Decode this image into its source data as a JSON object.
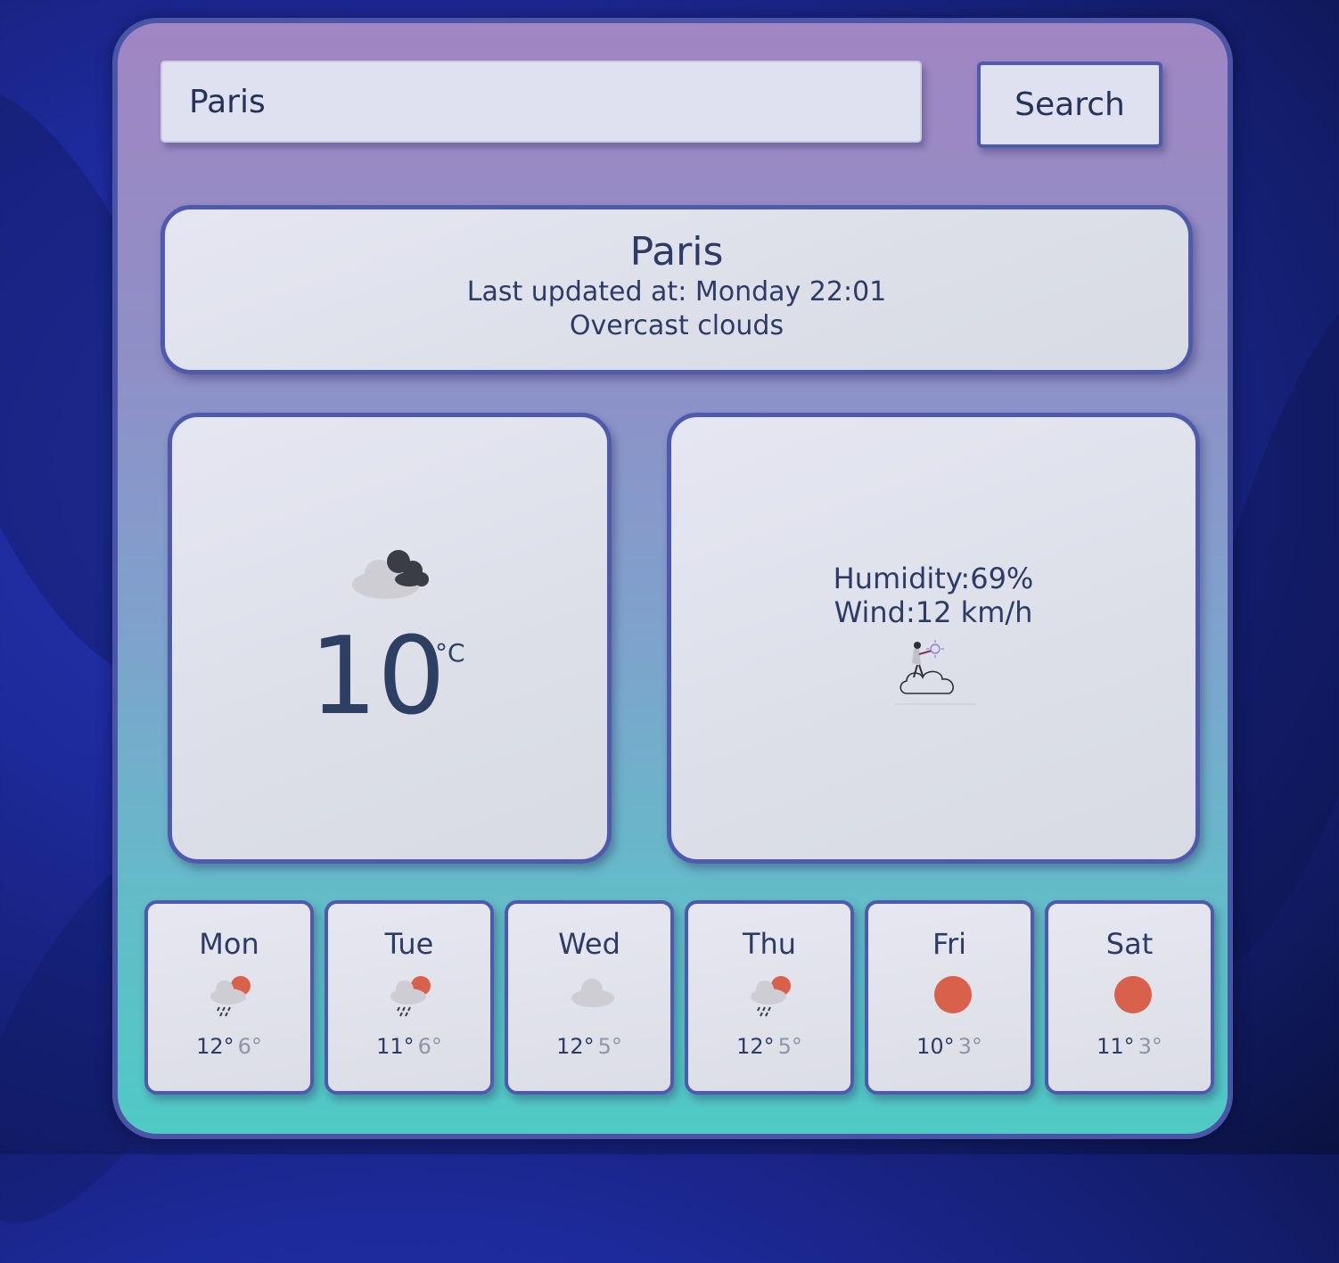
{
  "search": {
    "value": "Paris",
    "button_label": "Search"
  },
  "current": {
    "city": "Paris",
    "last_updated": "Last updated at: Monday 22:01",
    "description": "Overcast clouds",
    "temperature": "10",
    "unit": "°C",
    "icon": "overcast-clouds-icon",
    "humidity": "Humidity:69%",
    "wind": "Wind:12 km/h"
  },
  "forecast": [
    {
      "day": "Mon",
      "high": "12°",
      "low": "6°",
      "icon": "rain-sun-icon"
    },
    {
      "day": "Tue",
      "high": "11°",
      "low": "6°",
      "icon": "rain-sun-icon"
    },
    {
      "day": "Wed",
      "high": "12°",
      "low": "5°",
      "icon": "cloud-icon"
    },
    {
      "day": "Thu",
      "high": "12°",
      "low": "5°",
      "icon": "rain-sun-icon"
    },
    {
      "day": "Fri",
      "high": "10°",
      "low": "3°",
      "icon": "sun-icon"
    },
    {
      "day": "Sat",
      "high": "11°",
      "low": "3°",
      "icon": "sun-icon"
    }
  ],
  "colors": {
    "accent": "#4f5aac",
    "text": "#2c3c66",
    "sun": "#d9604a"
  }
}
